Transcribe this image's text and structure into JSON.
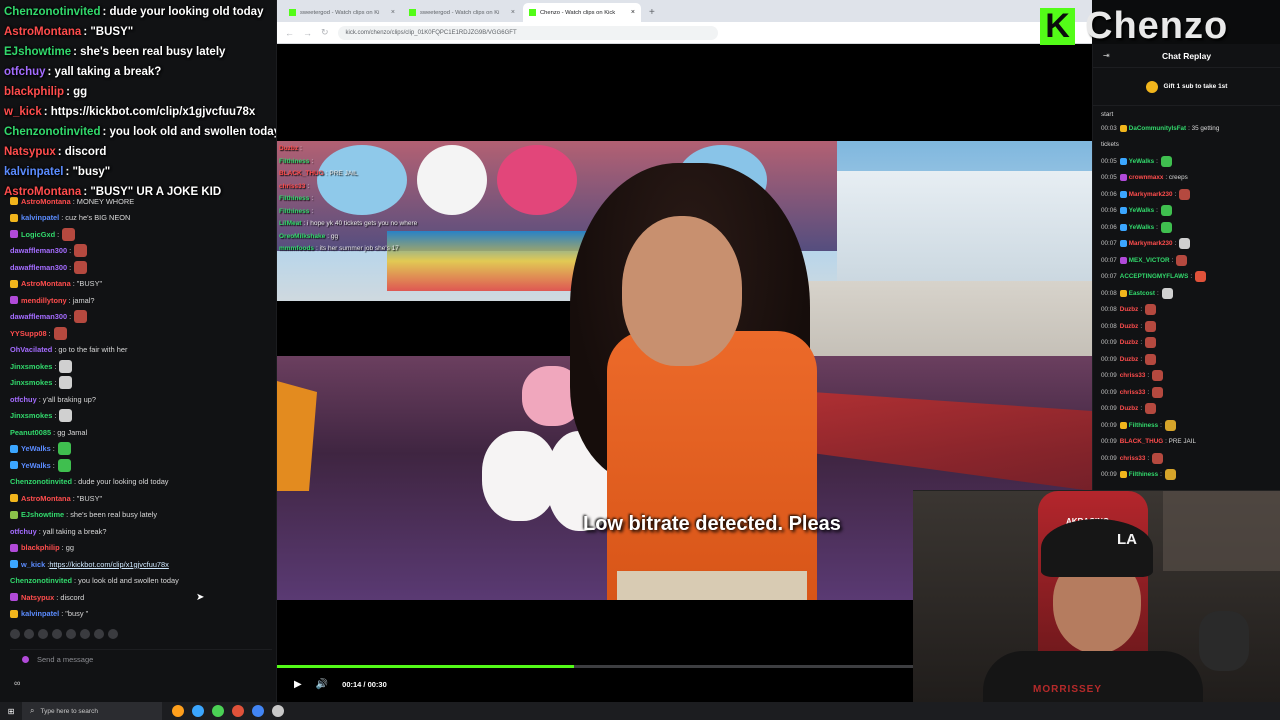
{
  "colors": {
    "kick_green": "#53fc18",
    "bg": "#0b0c0d",
    "panel": "#111214"
  },
  "left_chat": {
    "overlay_lines": [
      {
        "user": "Chenzonotinvited",
        "color": "#32d96c",
        "text": ": dude your looking old today"
      },
      {
        "user": "AstroMontana",
        "color": "#ff4d4d",
        "text": ": \"BUSY\""
      },
      {
        "user": "EJshowtime",
        "color": "#32d96c",
        "text": ": she's been real busy lately"
      },
      {
        "user": "otfchuy",
        "color": "#a46cff",
        "text": ": yall taking a break?"
      },
      {
        "user": "blackphilip",
        "color": "#ff4d4d",
        "text": ": gg"
      },
      {
        "user": "w_kick",
        "color": "#ff4d4d",
        "text": ": https://kickbot.com/clip/x1gjvcfuu78x"
      },
      {
        "user": "Chenzonotinvited",
        "color": "#32d96c",
        "text": ": you look old and swollen today"
      },
      {
        "user": "Natsypux",
        "color": "#ff4d4d",
        "text": ": discord"
      },
      {
        "user": "kalvinpatel",
        "color": "#5b8cff",
        "text": ": \"busy\""
      },
      {
        "user": "AstroMontana",
        "color": "#ff4d4d",
        "text": ": \"BUSY\" UR A JOKE KID"
      }
    ],
    "messages": [
      {
        "user": "AstroMontana",
        "color": "#ff4d4d",
        "badge": "#f1b51c",
        "text": ": MONEY WHORE",
        "emote": ""
      },
      {
        "user": "kalvinpatel",
        "color": "#5b8cff",
        "badge": "#f1b51c",
        "text": ": cuz he's BIG NEON",
        "emote": ""
      },
      {
        "user": "LogicGxd",
        "color": "#32d96c",
        "badge": "#b14ad9",
        "text": ":",
        "emote": "#b5493f"
      },
      {
        "user": "dawaffleman300",
        "color": "#a46cff",
        "badge": "",
        "text": ":",
        "emote": "#b5493f"
      },
      {
        "user": "dawaffleman300",
        "color": "#a46cff",
        "badge": "",
        "text": ":",
        "emote": "#b5493f"
      },
      {
        "user": "AstroMontana",
        "color": "#ff4d4d",
        "badge": "#f1b51c",
        "text": ": \"BUSY\"",
        "emote": ""
      },
      {
        "user": "mendillytony",
        "color": "#ff4d4d",
        "badge": "#b14ad9",
        "text": ": jamal?",
        "emote": ""
      },
      {
        "user": "dawaffleman300",
        "color": "#a46cff",
        "badge": "",
        "text": ":",
        "emote": "#b5493f"
      },
      {
        "user": "YYSupp08",
        "color": "#ff4d4d",
        "badge": "",
        "text": ":",
        "emote": "#b5493f"
      },
      {
        "user": "OhVacilated",
        "color": "#a46cff",
        "badge": "",
        "text": ": go to the fair with her",
        "emote": ""
      },
      {
        "user": "Jinxsmokes",
        "color": "#32d96c",
        "badge": "",
        "text": ":",
        "emote": "#d0d0d0"
      },
      {
        "user": "Jinxsmokes",
        "color": "#32d96c",
        "badge": "",
        "text": ":",
        "emote": "#d0d0d0"
      },
      {
        "user": "otfchuy",
        "color": "#a46cff",
        "badge": "",
        "text": ": y'all braking up?",
        "emote": ""
      },
      {
        "user": "Jinxsmokes",
        "color": "#32d96c",
        "badge": "",
        "text": ":",
        "emote": "#d0d0d0"
      },
      {
        "user": "Peanut0085",
        "color": "#32d96c",
        "badge": "",
        "text": ": gg Jamal",
        "emote": ""
      },
      {
        "user": "YeWalks",
        "color": "#5b8cff",
        "badge": "#3ba6ff",
        "text": ":",
        "emote": "#3fbf4f"
      },
      {
        "user": "YeWalks",
        "color": "#5b8cff",
        "badge": "#3ba6ff",
        "text": ":",
        "emote": "#3fbf4f"
      },
      {
        "user": "Chenzonotinvited",
        "color": "#32d96c",
        "badge": "",
        "text": ": dude your looking old today",
        "emote": ""
      },
      {
        "user": "AstroMontana",
        "color": "#ff4d4d",
        "badge": "#f1b51c",
        "text": ": \"BUSY\"",
        "emote": ""
      },
      {
        "user": "EJshowtime",
        "color": "#32d96c",
        "badge": "#8bc34a",
        "text": ": she's been real busy lately",
        "emote": ""
      },
      {
        "user": "otfchuy",
        "color": "#a46cff",
        "badge": "",
        "text": ": yall taking a break?",
        "emote": ""
      },
      {
        "user": "blackphilip",
        "color": "#ff4d4d",
        "badge": "#b14ad9",
        "text": ": gg",
        "emote": ""
      },
      {
        "user": "w_kick",
        "color": "#5b8cff",
        "badge": "#3ba6ff",
        "text": ": ",
        "link": "https://kickbot.com/clip/x1gjvcfuu78x",
        "emote": ""
      },
      {
        "user": "Chenzonotinvited",
        "color": "#32d96c",
        "badge": "",
        "text": ": you look old and swollen today",
        "emote": ""
      },
      {
        "user": "Natsypux",
        "color": "#ff4d4d",
        "badge": "#b14ad9",
        "text": ": discord",
        "emote": ""
      },
      {
        "user": "kalvinpatel",
        "color": "#5b8cff",
        "badge": "#f1b51c",
        "text": ": \"busy \"",
        "emote": ""
      }
    ],
    "send_placeholder": "Send a message",
    "footer": "∞"
  },
  "browser": {
    "tabs": [
      {
        "label": "sweetergod - Watch clips on Ki",
        "active": false
      },
      {
        "label": "sweetergod - Watch clips on Ki",
        "active": false
      },
      {
        "label": "Chenzo - Watch clips on Kick",
        "active": true
      }
    ],
    "new_tab": "+",
    "url": "kick.com/chenzo/clips/clip_01K0FQPC1E1RDJZG9B/VGG6GFT"
  },
  "video": {
    "overlay_chat": [
      {
        "user": "Duzbz",
        "color": "#ff4d4d",
        "text": ":"
      },
      {
        "user": "Filthiness",
        "color": "#32d96c",
        "text": ":"
      },
      {
        "user": "BLACK_THUG",
        "color": "#ff4d4d",
        "text": ": PRE JAIL"
      },
      {
        "user": "chriss33",
        "color": "#ff4d4d",
        "text": ":"
      },
      {
        "user": "Filthiness",
        "color": "#32d96c",
        "text": ":"
      },
      {
        "user": "Filthiness",
        "color": "#32d96c",
        "text": ":"
      },
      {
        "user": "LilMeat",
        "color": "#32d96c",
        "text": ": i hope yk 40 tickets gets you no where"
      },
      {
        "user": "OreoMilkshake",
        "color": "#32d96c",
        "text": ": gg"
      },
      {
        "user": "mmmfoods",
        "color": "#32d96c",
        "text": ": its her summer job she's 17"
      }
    ],
    "subtitle": "Low bitrate detected. Pleas",
    "progress": 0.467,
    "time": "00:14 / 00:30"
  },
  "channel": {
    "logo_letter": "K",
    "name": "Chenzo"
  },
  "right_chat": {
    "title": "Chat Replay",
    "gift": "Gift 1 sub to take 1st",
    "top_text": "start",
    "messages": [
      {
        "ts": "00:03",
        "user": "DaCommunityIsFat",
        "color": "#32d96c",
        "badge": "#f1b51c",
        "text": ": 35 getting",
        "emote": ""
      },
      {
        "ts": "",
        "user": "",
        "color": "#d8d8d8",
        "badge": "",
        "text": "tickets",
        "emote": ""
      },
      {
        "ts": "00:05",
        "user": "YeWalks",
        "color": "#32d96c",
        "badge": "#3ba6ff",
        "text": ":",
        "emote": "#3fbf4f"
      },
      {
        "ts": "00:05",
        "user": "crownmaxx",
        "color": "#ff4d4d",
        "badge": "#b14ad9",
        "text": ": creeps",
        "emote": ""
      },
      {
        "ts": "00:06",
        "user": "Markymark230",
        "color": "#ff4d4d",
        "badge": "#3ba6ff",
        "text": ":",
        "emote": "#b5493f"
      },
      {
        "ts": "00:06",
        "user": "YeWalks",
        "color": "#32d96c",
        "badge": "#3ba6ff",
        "text": ":",
        "emote": "#3fbf4f"
      },
      {
        "ts": "00:06",
        "user": "YeWalks",
        "color": "#32d96c",
        "badge": "#3ba6ff",
        "text": ":",
        "emote": "#3fbf4f"
      },
      {
        "ts": "00:07",
        "user": "Markymark230",
        "color": "#ff4d4d",
        "badge": "#3ba6ff",
        "text": ":",
        "emote": "#d0d0d0"
      },
      {
        "ts": "00:07",
        "user": "MEX_VICTOR",
        "color": "#32d96c",
        "badge": "#b14ad9",
        "text": ":",
        "emote": "#b5493f"
      },
      {
        "ts": "00:07",
        "user": "ACCEPTINGMYFLAWS",
        "color": "#32d96c",
        "badge": "",
        "text": ":",
        "emote": "#e0523a"
      },
      {
        "ts": "00:08",
        "user": "Eastcost",
        "color": "#32d96c",
        "badge": "#f1b51c",
        "text": ":",
        "emote": "#d0d0d0"
      },
      {
        "ts": "00:08",
        "user": "Duzbz",
        "color": "#ff4d4d",
        "badge": "",
        "text": ":",
        "emote": "#b5493f"
      },
      {
        "ts": "00:08",
        "user": "Duzbz",
        "color": "#ff4d4d",
        "badge": "",
        "text": ":",
        "emote": "#b5493f"
      },
      {
        "ts": "00:09",
        "user": "Duzbz",
        "color": "#ff4d4d",
        "badge": "",
        "text": ":",
        "emote": "#b5493f"
      },
      {
        "ts": "00:09",
        "user": "Duzbz",
        "color": "#ff4d4d",
        "badge": "",
        "text": ":",
        "emote": "#b5493f"
      },
      {
        "ts": "00:09",
        "user": "chriss33",
        "color": "#ff4d4d",
        "badge": "",
        "text": ":",
        "emote": "#b5493f"
      },
      {
        "ts": "00:09",
        "user": "chriss33",
        "color": "#ff4d4d",
        "badge": "",
        "text": ":",
        "emote": "#b5493f"
      },
      {
        "ts": "00:09",
        "user": "Duzbz",
        "color": "#ff4d4d",
        "badge": "",
        "text": ":",
        "emote": "#b5493f"
      },
      {
        "ts": "00:09",
        "user": "Filthiness",
        "color": "#32d96c",
        "badge": "#f1b51c",
        "text": ":",
        "emote": "#d6a42a"
      },
      {
        "ts": "00:09",
        "user": "BLACK_THUG",
        "color": "#ff4d4d",
        "badge": "",
        "text": ": PRE JAIL",
        "emote": ""
      },
      {
        "ts": "00:09",
        "user": "chriss33",
        "color": "#ff4d4d",
        "badge": "",
        "text": ":",
        "emote": "#b5493f"
      },
      {
        "ts": "00:09",
        "user": "Filthiness",
        "color": "#32d96c",
        "badge": "#f1b51c",
        "text": ":",
        "emote": "#d6a42a"
      }
    ]
  },
  "webcam": {
    "chair_text": "AKRACING",
    "cap_text": "LA",
    "shirt_text": "MORRISSEY"
  },
  "taskbar": {
    "search_placeholder": "Type here to search",
    "apps": [
      "#ff9f1c",
      "#3ba6ff",
      "#4bd155",
      "#e0523a",
      "#4285f4",
      "#c8c8c8"
    ]
  }
}
